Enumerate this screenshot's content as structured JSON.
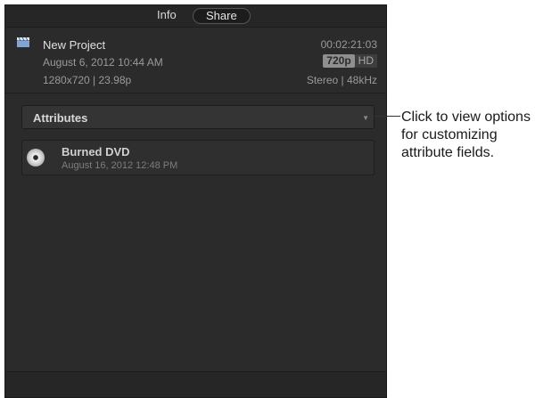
{
  "tabs": {
    "info": "Info",
    "share": "Share"
  },
  "project": {
    "name": "New Project",
    "date": "August 6, 2012 10:44 AM",
    "format": "1280x720  |  23.98p",
    "duration": "00:02:21:03",
    "res_badge": "720p",
    "hd_badge": "HD",
    "audio": "Stereo  |  48kHz",
    "icon": "clapper-icon"
  },
  "attributes": {
    "label": "Attributes"
  },
  "share_item": {
    "name": "Burned DVD",
    "date": "August 16, 2012 12:48 PM",
    "icon": "dvd-icon"
  },
  "callout": {
    "line1": "Click to view options",
    "line2": "for customizing",
    "line3": "attribute fields."
  },
  "colors": {
    "panel": "#2b2b2b",
    "text": "#e0e0e0"
  }
}
